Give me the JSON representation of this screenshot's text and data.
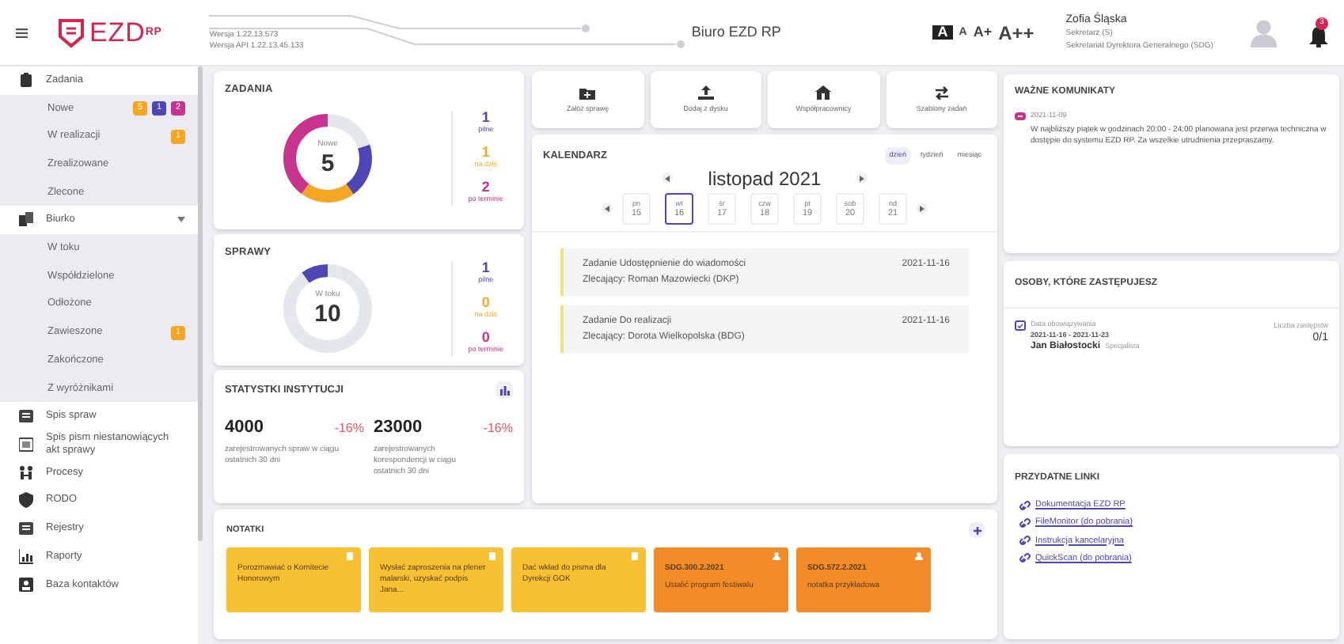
{
  "header": {
    "versions": [
      "Wersja 1.22.13.573",
      "Wersja API 1.22.13.45.133"
    ],
    "title": "Biuro EZD RP",
    "font_sizes": [
      {
        "label": "A",
        "selected": true
      },
      {
        "label": "A",
        "selected": false
      },
      {
        "label": "A+",
        "selected": false
      },
      {
        "label": "A++",
        "selected": false
      }
    ],
    "user": {
      "name": "Zofia Śląska",
      "role": "Sekretarz (S)",
      "unit": "Sekretariat Dyrektora Generalnego (SDG)"
    },
    "notifications": "3"
  },
  "logo": {
    "text": "EZD",
    "sup": "RP"
  },
  "sidebar": {
    "items": [
      {
        "label": "Zadania",
        "children": [
          {
            "label": "Nowe",
            "badges": [
              {
                "text": "5",
                "color": "#f5a623"
              },
              {
                "text": "1",
                "color": "#4f46b5"
              },
              {
                "text": "2",
                "color": "#c8338f"
              }
            ]
          },
          {
            "label": "W realizacji",
            "badges": [
              {
                "text": "1",
                "color": "#f5a623"
              }
            ]
          },
          {
            "label": "Zrealizowane"
          },
          {
            "label": "Zlecone"
          }
        ]
      },
      {
        "label": "Biurko",
        "expanded": true,
        "children": [
          {
            "label": "W toku"
          },
          {
            "label": "Współdzielone"
          },
          {
            "label": "Odłożone"
          },
          {
            "label": "Zawieszone",
            "badges": [
              {
                "text": "1",
                "color": "#f5a623"
              }
            ]
          },
          {
            "label": "Zakończone"
          },
          {
            "label": "Z wyróżnikami"
          }
        ]
      },
      {
        "label": "Spis spraw"
      },
      {
        "label": "Spis pism niestanowiących akt sprawy"
      },
      {
        "label": "Procesy"
      },
      {
        "label": "RODO"
      },
      {
        "label": "Rejestry"
      },
      {
        "label": "Raporty"
      },
      {
        "label": "Baza kontaktów"
      }
    ]
  },
  "zadania": {
    "title": "ZADANIA",
    "center_label": "Nowe",
    "total": "5",
    "legend": [
      {
        "value": "1",
        "label": "pilne",
        "color": "#4f46b5"
      },
      {
        "value": "1",
        "label": "na dziś",
        "color": "#f5a623"
      },
      {
        "value": "2",
        "label": "po terminie",
        "color": "#c8338f"
      }
    ]
  },
  "sprawy": {
    "title": "SPRAWY",
    "center_label": "W toku",
    "total": "10",
    "legend": [
      {
        "value": "1",
        "label": "pilne",
        "color": "#4f46b5"
      },
      {
        "value": "0",
        "label": "na dziś",
        "color": "#f5a623"
      },
      {
        "value": "0",
        "label": "po terminie",
        "color": "#c8338f"
      }
    ]
  },
  "statystyki": {
    "title": "STATYSTKI INSTYTUCJI",
    "items": [
      {
        "value": "4000",
        "change": "-16%",
        "description": "zarejestrowanych spraw w ciągu ostatnich 30 dni"
      },
      {
        "value": "23000",
        "change": "-16%",
        "description": "zarejestrowanych korespondencji w ciągu ostatnich 30 dni"
      }
    ]
  },
  "actions": [
    {
      "label": "Załóż sprawę"
    },
    {
      "label": "Dodaj z dysku"
    },
    {
      "label": "Współpracownicy"
    },
    {
      "label": "Szablony zadań"
    }
  ],
  "calendar": {
    "title": "KALENDARZ",
    "views": [
      {
        "label": "dzień",
        "selected": true
      },
      {
        "label": "tydzień",
        "selected": false
      },
      {
        "label": "miesiąc",
        "selected": false
      }
    ],
    "month": "listopad 2021",
    "days": [
      {
        "name": "pn",
        "date": "15",
        "selected": false
      },
      {
        "name": "wt",
        "date": "16",
        "selected": true
      },
      {
        "name": "śr",
        "date": "17",
        "selected": false
      },
      {
        "name": "czw",
        "date": "18",
        "selected": false
      },
      {
        "name": "pt",
        "date": "19",
        "selected": false
      },
      {
        "name": "sob",
        "date": "20",
        "selected": false
      },
      {
        "name": "nd",
        "date": "21",
        "selected": false
      }
    ],
    "events": [
      {
        "title": "Zadanie Udostępnienie do wiadomości",
        "assigner": "Zlecający: Roman Mazowiecki (DKP)",
        "date": "2021-11-16"
      },
      {
        "title": "Zadanie Do realizacji",
        "assigner": "Zlecający: Dorota Wielkopolska (BDG)",
        "date": "2021-11-16"
      }
    ]
  },
  "notes": {
    "title": "NOTATKI",
    "items": [
      {
        "kind": "personal",
        "color": "#f6c234",
        "text": "Porozmawiać o Komitecie Honorowym"
      },
      {
        "kind": "personal",
        "color": "#f6c234",
        "text": "Wysłać zaproszenia na plener malarski, uzyskać podpis Jana..."
      },
      {
        "kind": "personal",
        "color": "#f6c234",
        "text": "Dać wkład do pisma dla Dyrekcji GOK"
      },
      {
        "kind": "case",
        "color": "#f28c28",
        "title": "SDG.300.2.2021",
        "text": "Ustalić program festiwalu"
      },
      {
        "kind": "case",
        "color": "#f28c28",
        "title": "SDG.572.2.2021",
        "text": "notatka przykładowa"
      }
    ]
  },
  "announcements": {
    "title": "WAŻNE KOMUNIKATY",
    "items": [
      {
        "date": "2021-11-09",
        "text": "W najbliższy piątek w godzinach 20:00 - 24:00 planowana jest przerwa techniczna w dostępie do systemu EZD RP. Za wszelkie utrudnienia przepraszamy."
      }
    ]
  },
  "substitutions": {
    "title": "OSOBY, KTÓRE ZASTĘPUJESZ",
    "items": [
      {
        "period_label": "Data obowiązywania",
        "period": "2021-11-16 - 2021-11-23",
        "name": "Jan Białostocki",
        "position": "Specjalista",
        "count_label": "Liczba zastępstw",
        "count": "0/1"
      }
    ]
  },
  "links": {
    "title": "PRZYDATNE LINKI",
    "items": [
      "Dokumentacja EZD RP",
      "FileMonitor (do pobrania)",
      "Instrukcja kancelaryjna",
      "QuickScan (do pobrania)"
    ]
  }
}
